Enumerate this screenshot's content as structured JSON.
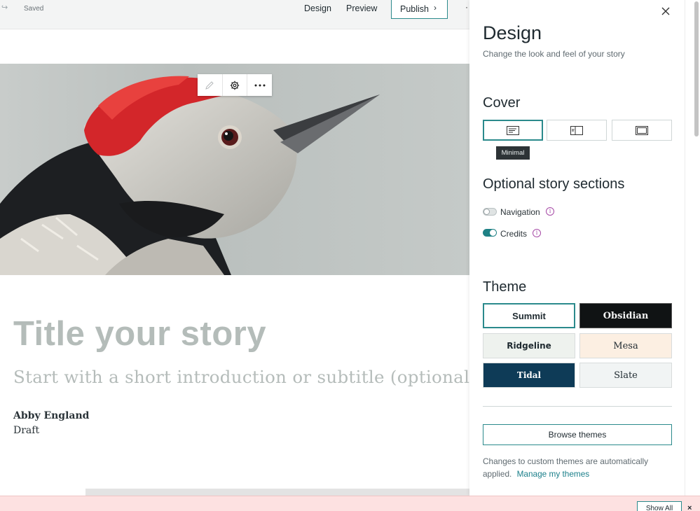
{
  "topbar": {
    "saved_label": "Saved",
    "nav": {
      "design": "Design",
      "preview": "Preview"
    },
    "publish_label": "Publish",
    "publish_chevron": "›",
    "more_label": "·"
  },
  "story": {
    "title_placeholder": "Title your story",
    "subtitle_placeholder": "Start with a short introduction or subtitle (optional)",
    "author": "Abby England",
    "status": "Draft"
  },
  "panel": {
    "title": "Design",
    "subtitle": "Change the look and feel of your story",
    "cover": {
      "heading": "Cover",
      "options": [
        "minimal",
        "side-by-side",
        "full"
      ],
      "selected": "minimal",
      "tooltip": "Minimal"
    },
    "sections": {
      "heading": "Optional story sections",
      "items": [
        {
          "label": "Navigation",
          "enabled": false
        },
        {
          "label": "Credits",
          "enabled": true
        }
      ]
    },
    "theme": {
      "heading": "Theme",
      "options": [
        {
          "label": "Summit",
          "selected": true
        },
        {
          "label": "Obsidian",
          "selected": false
        },
        {
          "label": "Ridgeline",
          "selected": false
        },
        {
          "label": "Mesa",
          "selected": false
        },
        {
          "label": "Tidal",
          "selected": false
        },
        {
          "label": "Slate",
          "selected": false
        }
      ]
    },
    "browse_label": "Browse themes",
    "changes_text": "Changes to custom themes are automatically applied.",
    "manage_link": "Manage my themes"
  },
  "banner": {
    "show_all_label": "Show All",
    "close_label": "×"
  },
  "colors": {
    "accent": "#2b8a8c",
    "toggle_on": "#1f8185",
    "info": "#a64aa6",
    "banner": "#fde1e1"
  }
}
